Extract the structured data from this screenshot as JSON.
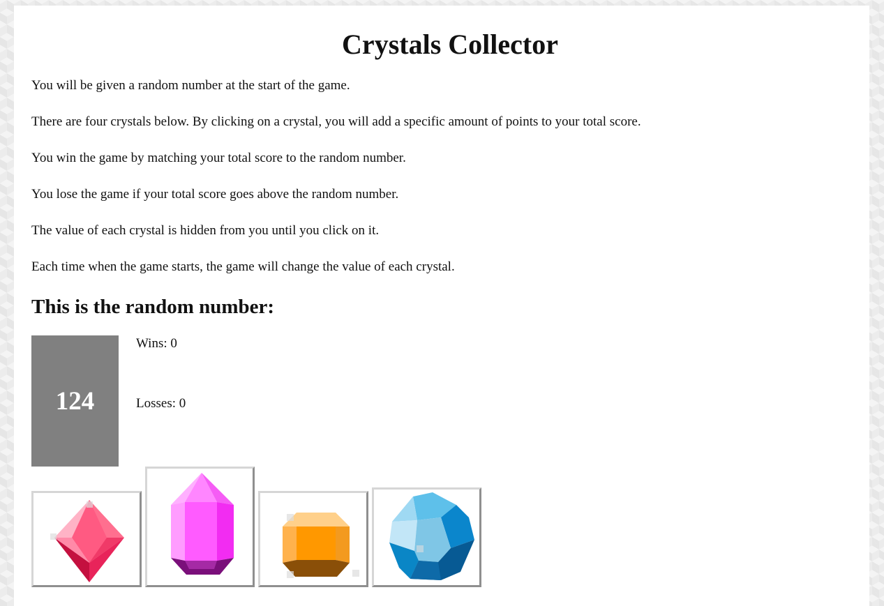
{
  "page": {
    "title": "Crystals Collector"
  },
  "instructions": [
    "You will be given a random number at the start of the game.",
    "There are four crystals below. By clicking on a crystal, you will add a specific amount of points to your total score.",
    "You win the game by matching your total score to the random number.",
    "You lose the game if your total score goes above the random number.",
    "The value of each crystal is hidden from you until you click on it.",
    "Each time when the game starts, the game will change the value of each crystal."
  ],
  "game": {
    "random_heading": "This is the random number:",
    "random_number": "124",
    "wins_text": "Wins: 0",
    "losses_text": "Losses: 0"
  },
  "crystals": [
    {
      "icon": "red-octahedron-crystal-icon",
      "color": "#e8245a"
    },
    {
      "icon": "pink-prism-crystal-icon",
      "color": "#f23ef2"
    },
    {
      "icon": "orange-square-crystal-icon",
      "color": "#f7a12b"
    },
    {
      "icon": "blue-oval-crystal-icon",
      "color": "#1e8fd0"
    }
  ]
}
